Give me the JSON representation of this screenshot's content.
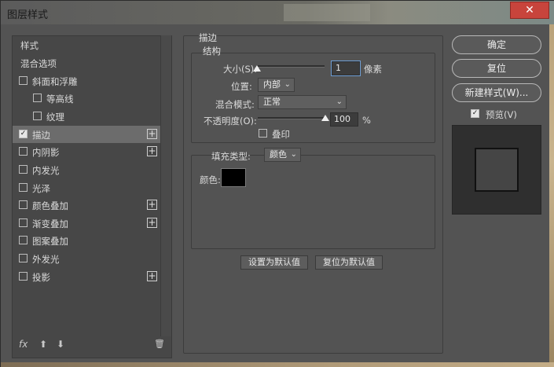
{
  "window": {
    "title": "图层样式",
    "close": "✕"
  },
  "left_panel": {
    "items": [
      {
        "label": "样式",
        "checkbox": false,
        "checked": false,
        "plus": false,
        "selected": false
      },
      {
        "label": "混合选项",
        "checkbox": false,
        "checked": false,
        "plus": false,
        "selected": false
      },
      {
        "label": "斜面和浮雕",
        "checkbox": true,
        "checked": false,
        "plus": false,
        "selected": false
      },
      {
        "label": "等高线",
        "checkbox": true,
        "checked": false,
        "plus": false,
        "selected": false
      },
      {
        "label": "纹理",
        "checkbox": true,
        "checked": false,
        "plus": false,
        "selected": false
      },
      {
        "label": "描边",
        "checkbox": true,
        "checked": true,
        "plus": true,
        "selected": true
      },
      {
        "label": "内阴影",
        "checkbox": true,
        "checked": false,
        "plus": true,
        "selected": false
      },
      {
        "label": "内发光",
        "checkbox": true,
        "checked": false,
        "plus": false,
        "selected": false
      },
      {
        "label": "光泽",
        "checkbox": true,
        "checked": false,
        "plus": false,
        "selected": false
      },
      {
        "label": "颜色叠加",
        "checkbox": true,
        "checked": false,
        "plus": true,
        "selected": false
      },
      {
        "label": "渐变叠加",
        "checkbox": true,
        "checked": false,
        "plus": true,
        "selected": false
      },
      {
        "label": "图案叠加",
        "checkbox": true,
        "checked": false,
        "plus": false,
        "selected": false
      },
      {
        "label": "外发光",
        "checkbox": true,
        "checked": false,
        "plus": false,
        "selected": false
      },
      {
        "label": "投影",
        "checkbox": true,
        "checked": false,
        "plus": true,
        "selected": false
      }
    ],
    "footer": {
      "fx": "fx",
      "up": "⬆",
      "down": "⬇",
      "trash": "🗑"
    }
  },
  "stroke": {
    "section_title": "描边",
    "structure_title": "结构",
    "size_label": "大小(S):",
    "size_value": "1",
    "size_unit": "像素",
    "size_fraction": 0.0,
    "position_label": "位置:",
    "position_value": "内部",
    "blend_label": "混合模式:",
    "blend_value": "正常",
    "opacity_label": "不透明度(O):",
    "opacity_value": "100",
    "opacity_unit": "%",
    "opacity_fraction": 1.0,
    "overprint_label": "叠印",
    "fill_type_label": "填充类型:",
    "fill_type_value": "颜色",
    "color_label": "颜色:",
    "color": "#000000",
    "set_default_button": "设置为默认值",
    "reset_default_button": "复位为默认值"
  },
  "right_panel": {
    "ok_button": "确定",
    "reset_button": "复位",
    "new_style_button": "新建样式(W)...",
    "preview_label": "预览(V)",
    "preview_checked": true
  }
}
